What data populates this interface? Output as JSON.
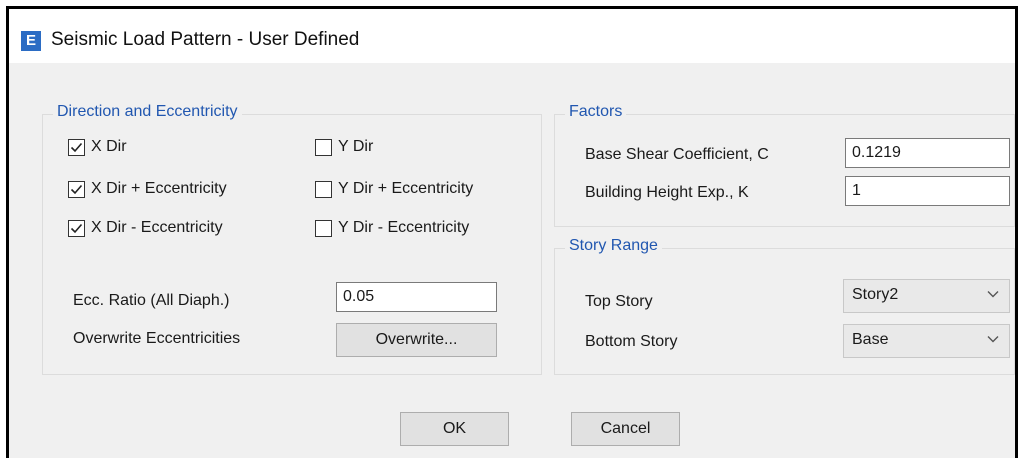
{
  "window": {
    "title": "Seismic Load Pattern - User Defined",
    "icon_letter": "E"
  },
  "direction_group": {
    "legend": "Direction and Eccentricity",
    "checkboxes": [
      {
        "label": "X Dir",
        "checked": true
      },
      {
        "label": "X Dir + Eccentricity",
        "checked": true
      },
      {
        "label": "X Dir - Eccentricity",
        "checked": true
      },
      {
        "label": "Y Dir",
        "checked": false
      },
      {
        "label": "Y Dir + Eccentricity",
        "checked": false
      },
      {
        "label": "Y Dir - Eccentricity",
        "checked": false
      }
    ],
    "ecc_ratio_label": "Ecc. Ratio (All Diaph.)",
    "ecc_ratio_value": "0.05",
    "overwrite_label": "Overwrite Eccentricities",
    "overwrite_button": "Overwrite..."
  },
  "factors_group": {
    "legend": "Factors",
    "base_shear_label": "Base Shear Coefficient, C",
    "base_shear_value": "0.1219",
    "height_exp_label": "Building Height Exp., K",
    "height_exp_value": "1"
  },
  "story_range_group": {
    "legend": "Story Range",
    "top_story_label": "Top Story",
    "top_story_value": "Story2",
    "bottom_story_label": "Bottom Story",
    "bottom_story_value": "Base"
  },
  "buttons": {
    "ok": "OK",
    "cancel": "Cancel"
  },
  "colors": {
    "legend_text": "#2157b0",
    "dialog_bg": "#f0f0f0",
    "button_bg": "#e1e1e1"
  }
}
